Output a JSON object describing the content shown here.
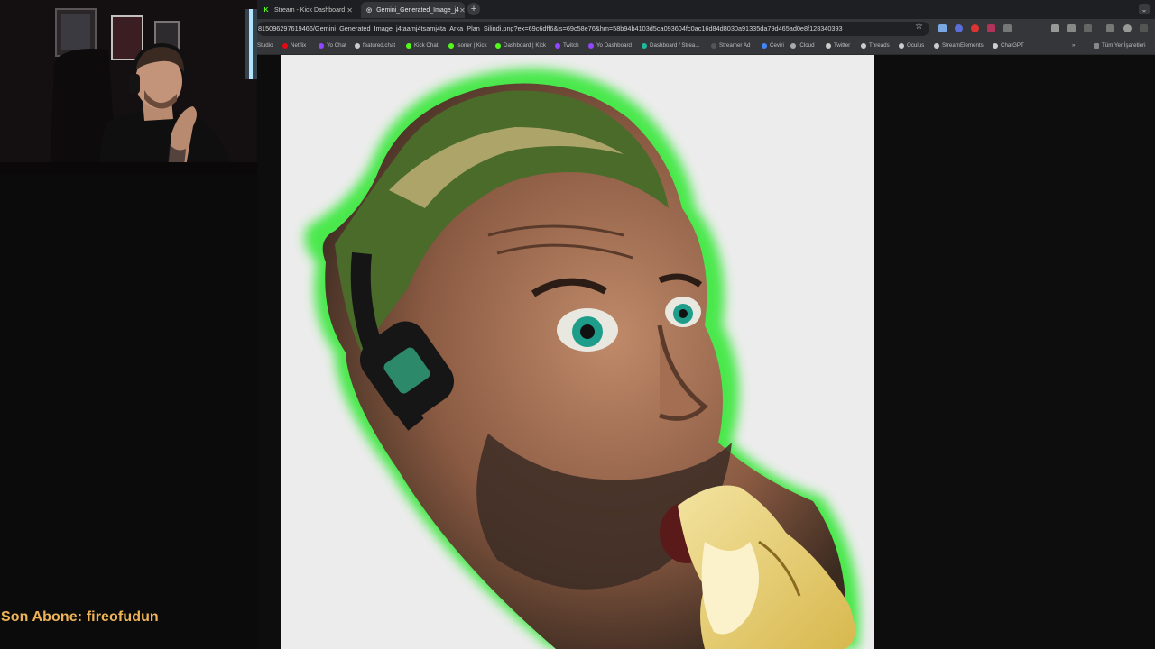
{
  "tabs": [
    {
      "label": "Stream - Kick Dashboard",
      "icon": "kick-icon",
      "active": false
    },
    {
      "label": "Gemini_Generated_Image_j4",
      "icon": "globe-icon",
      "active": true
    }
  ],
  "address_bar": {
    "url": "815096297619466/Gemini_Generated_Image_j4taamj4tsamj4ta_Arka_Plan_Silindi.png?ex=69c6dff6&is=69c58e76&hm=58b94b4103d5ca093604fc0ac16d84d8030a91335da79d465ad0e8f128340393"
  },
  "bookmarks": [
    {
      "label": "Studio",
      "color": "#888888"
    },
    {
      "label": "Netflix",
      "color": "#e50914"
    },
    {
      "label": "Yo Chat",
      "color": "#9146ff"
    },
    {
      "label": "featured.chat",
      "color": "#cccccc"
    },
    {
      "label": "Kick Chat",
      "color": "#53fc18"
    },
    {
      "label": "isoner | Kick",
      "color": "#53fc18"
    },
    {
      "label": "Dashboard | Kick",
      "color": "#53fc18"
    },
    {
      "label": "Twitch",
      "color": "#9146ff"
    },
    {
      "label": "Yo Dashboard",
      "color": "#9146ff"
    },
    {
      "label": "Dashboard / Strea...",
      "color": "#1fb89a"
    },
    {
      "label": "Streamer Ad",
      "color": "#555555"
    },
    {
      "label": "Çeviri",
      "color": "#4285f4"
    },
    {
      "label": "iCloud",
      "color": "#aaaaaa"
    },
    {
      "label": "Twitter",
      "color": "#cccccc"
    },
    {
      "label": "Threads",
      "color": "#cccccc"
    },
    {
      "label": "Oculus",
      "color": "#cccccc"
    },
    {
      "label": "StreamElements",
      "color": "#cccccc"
    },
    {
      "label": "ChatGPT",
      "color": "#cccccc"
    }
  ],
  "all_bookmarks_label": "Tüm Yer İşaretleri",
  "subscriber_text": "Son Abone: fireofudun",
  "colors": {
    "accent_green": "#39e83a",
    "subscriber_text": "#f0b457",
    "image_bg": "#ececec"
  }
}
